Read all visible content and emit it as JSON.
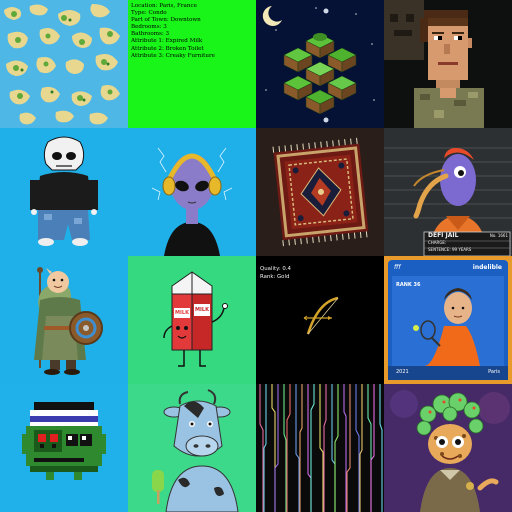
{
  "gallery": {
    "tiles": [
      {
        "name": "island-map-tile",
        "bg": "#4fb7e6"
      },
      {
        "name": "condo-metadata-tile",
        "bg": "#19f518"
      },
      {
        "name": "isometric-cube-tile",
        "bg": "#061235"
      },
      {
        "name": "pixel-portrait-tile",
        "bg": "#0e0f0f"
      },
      {
        "name": "skull-character-tile",
        "bg": "#1fb0e9"
      },
      {
        "name": "alien-headphones-tile",
        "bg": "#1fb0e9"
      },
      {
        "name": "persian-rug-tile",
        "bg": "#1c1513"
      },
      {
        "name": "defi-jail-bird-tile",
        "bg": "#2d3033"
      },
      {
        "name": "viking-character-tile",
        "bg": "#1fb0e9"
      },
      {
        "name": "milk-carton-tile",
        "bg": "#35d980"
      },
      {
        "name": "bow-quality-tile",
        "bg": "#000000"
      },
      {
        "name": "tennis-player-card-tile",
        "bg": "#1b5fc2"
      },
      {
        "name": "pixel-frog-tile",
        "bg": "#20b1ea"
      },
      {
        "name": "cow-popsicle-tile",
        "bg": "#3dd98a"
      },
      {
        "name": "glitch-lines-tile",
        "bg": "#0a0a0a"
      },
      {
        "name": "medusa-cop-tile",
        "bg": "#462a68"
      }
    ]
  },
  "condo": {
    "lines": [
      "Location: Paris, France",
      "Type: Condo",
      "Part of Town: Downtown",
      "Bedrooms: 3",
      "Bathrooms: 3",
      "Attribute 1: Expired Milk",
      "Attribute 2: Broken Toilet",
      "Attribute 3: Creaky Furniture"
    ]
  },
  "bow": {
    "quality": "Quality: 0.4",
    "rank": "Rank: Gold"
  },
  "jail": {
    "title": "DEFI JAIL",
    "number": "No. 1661",
    "charge_label": "CHARGE:",
    "sentence": "SENTENCE: 99 YEARS"
  },
  "milk": {
    "label_left": "MILK",
    "label_right": "MILK"
  },
  "tennis": {
    "brand_left": "fff",
    "brand_right": "indelible",
    "rank": "RANK 36",
    "year": "2021",
    "city": "Paris"
  }
}
